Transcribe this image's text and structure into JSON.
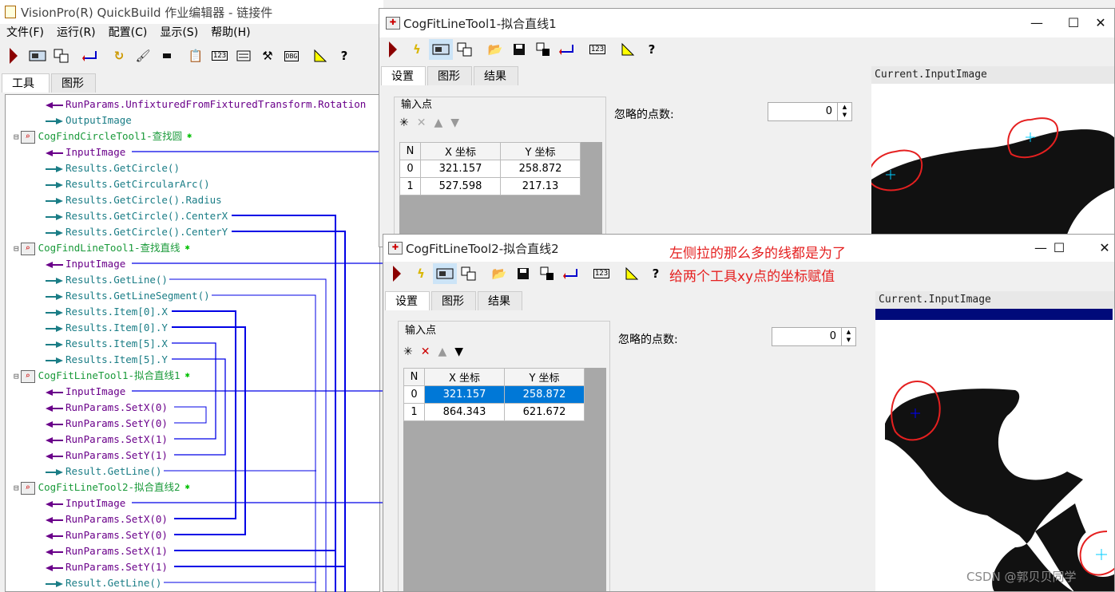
{
  "main": {
    "title": "VisionPro(R) QuickBuild 作业编辑器 - 链接件",
    "menus": [
      "文件(F)",
      "运行(R)",
      "配置(C)",
      "显示(S)",
      "帮助(H)"
    ],
    "tabs": [
      "工具",
      "图形"
    ],
    "tree": [
      {
        "text": "RunParams.UnfixturedFromFixturedTransform.Rotation",
        "kind": "in"
      },
      {
        "text": "OutputImage",
        "kind": "out"
      },
      {
        "text": "CogFindCircleTool1-查找圆",
        "kind": "tool"
      },
      {
        "text": "InputImage",
        "kind": "in"
      },
      {
        "text": "Results.GetCircle()",
        "kind": "out"
      },
      {
        "text": "Results.GetCircularArc()",
        "kind": "out"
      },
      {
        "text": "Results.GetCircle().Radius",
        "kind": "out"
      },
      {
        "text": "Results.GetCircle().CenterX",
        "kind": "out"
      },
      {
        "text": "Results.GetCircle().CenterY",
        "kind": "out"
      },
      {
        "text": "CogFindLineTool1-查找直线",
        "kind": "tool"
      },
      {
        "text": "InputImage",
        "kind": "in"
      },
      {
        "text": "Results.GetLine()",
        "kind": "out"
      },
      {
        "text": "Results.GetLineSegment()",
        "kind": "out"
      },
      {
        "text": "Results.Item[0].X",
        "kind": "out"
      },
      {
        "text": "Results.Item[0].Y",
        "kind": "out"
      },
      {
        "text": "Results.Item[5].X",
        "kind": "out"
      },
      {
        "text": "Results.Item[5].Y",
        "kind": "out"
      },
      {
        "text": "CogFitLineTool1-拟合直线1",
        "kind": "tool"
      },
      {
        "text": "InputImage",
        "kind": "in"
      },
      {
        "text": "RunParams.SetX(0)",
        "kind": "in"
      },
      {
        "text": "RunParams.SetY(0)",
        "kind": "in"
      },
      {
        "text": "RunParams.SetX(1)",
        "kind": "in"
      },
      {
        "text": "RunParams.SetY(1)",
        "kind": "in"
      },
      {
        "text": "Result.GetLine()",
        "kind": "out"
      },
      {
        "text": "CogFitLineTool2-拟合直线2",
        "kind": "tool"
      },
      {
        "text": "InputImage",
        "kind": "in"
      },
      {
        "text": "RunParams.SetX(0)",
        "kind": "in"
      },
      {
        "text": "RunParams.SetY(0)",
        "kind": "in"
      },
      {
        "text": "RunParams.SetX(1)",
        "kind": "in"
      },
      {
        "text": "RunParams.SetY(1)",
        "kind": "in"
      },
      {
        "text": "Result.GetLine()",
        "kind": "out"
      }
    ]
  },
  "fit1": {
    "title": "CogFitLineTool1-拟合直线1",
    "tabs": [
      "设置",
      "图形",
      "结果"
    ],
    "group_label": "输入点",
    "ignore_label": "忽略的点数:",
    "ignore_value": "0",
    "col_n": "N",
    "col_x": "X 坐标",
    "col_y": "Y 坐标",
    "rows": [
      [
        "0",
        "321.157",
        "258.872"
      ],
      [
        "1",
        "527.598",
        "217.13"
      ]
    ],
    "image_label": "Current.InputImage"
  },
  "fit2": {
    "title": "CogFitLineTool2-拟合直线2",
    "tabs": [
      "设置",
      "图形",
      "结果"
    ],
    "group_label": "输入点",
    "ignore_label": "忽略的点数:",
    "ignore_value": "0",
    "col_n": "N",
    "col_x": "X 坐标",
    "col_y": "Y 坐标",
    "rows": [
      [
        "0",
        "321.157",
        "258.872"
      ],
      [
        "1",
        "864.343",
        "621.672"
      ]
    ],
    "image_label": "Current.InputImage"
  },
  "annotation": {
    "line1": "左侧拉的那么多的线都是为了",
    "line2": "给两个工具xy点的坐标赋值"
  },
  "watermark": "CSDN @郭贝贝同学",
  "colors": {
    "link": "#0000e6",
    "input": "#6a008a",
    "output": "#1a7d86",
    "annotation": "#e52020",
    "selected_row": "#0078d7"
  }
}
